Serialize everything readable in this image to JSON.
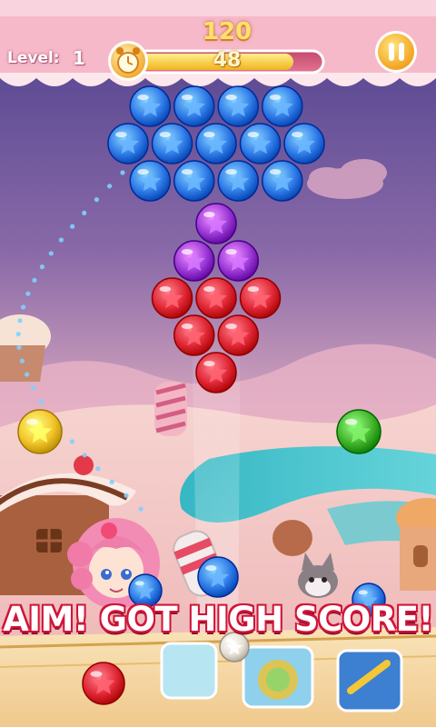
{
  "hud": {
    "level_label": "Level:",
    "level": "1",
    "score": "120",
    "moves_left": "48",
    "timer_fill": 0.85
  },
  "icons": {
    "pause": "pause-icon",
    "timer": "alarm-clock-icon",
    "bubble_symbol": "star-icon"
  },
  "colors": {
    "blue": "#2f7be8",
    "purple": "#9a39d6",
    "red": "#e02735",
    "yellow": "#f2c52b",
    "green": "#43b52c",
    "white": "#e8e0d4"
  },
  "board": {
    "rows": [
      [
        "blue",
        "blue",
        "blue",
        "blue"
      ],
      [
        "blue",
        "blue",
        "blue",
        "blue",
        "blue"
      ],
      [
        "blue",
        "blue",
        "blue",
        "blue"
      ],
      [
        "purple"
      ],
      [
        "purple",
        "purple"
      ],
      [
        "red",
        "red",
        "red"
      ],
      [
        "red",
        "red"
      ],
      [
        "red"
      ]
    ]
  },
  "side_bubbles": {
    "left": "yellow",
    "right": "green"
  },
  "shooter": {
    "loaded": "blue",
    "next": "white",
    "reserve": "red"
  },
  "banner": "AIM! GOT HIGH SCORE!"
}
